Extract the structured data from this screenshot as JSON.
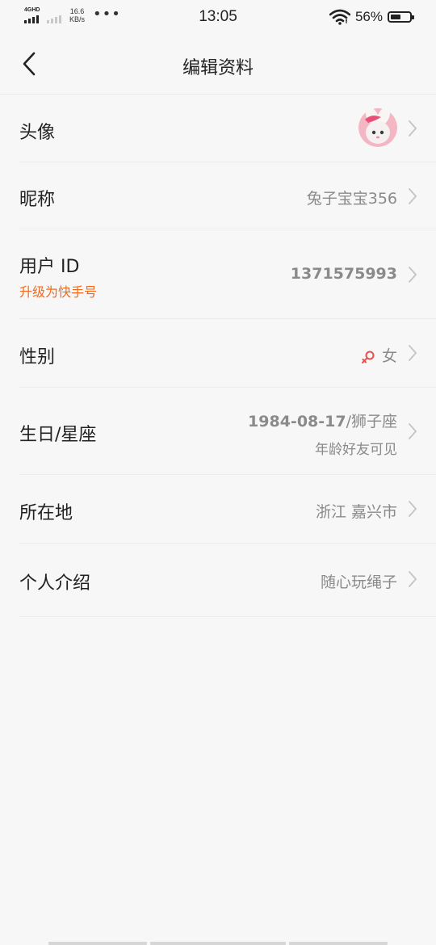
{
  "status_bar": {
    "network_tag": "4GHD",
    "speed_value": "16.6",
    "speed_unit": "KB/s",
    "more_dots": "•••",
    "time": "13:05",
    "battery_percent": "56%",
    "battery_level": 0.56
  },
  "header": {
    "title": "编辑资料",
    "back_icon": "chevron-left-icon"
  },
  "rows": {
    "avatar": {
      "label": "头像"
    },
    "nickname": {
      "label": "昵称",
      "value": "兔子宝宝356"
    },
    "user_id": {
      "label": "用户 ID",
      "sub": "升级为快手号",
      "value": "1371575993"
    },
    "gender": {
      "label": "性别",
      "value": "女",
      "icon": "female-icon"
    },
    "birthday": {
      "label": "生日/星座",
      "date": "1984-08-17",
      "zodiac": "/狮子座",
      "visibility": "年龄好友可见"
    },
    "location": {
      "label": "所在地",
      "value": "浙江 嘉兴市"
    },
    "intro": {
      "label": "个人介绍",
      "value": "随心玩绳子"
    }
  },
  "colors": {
    "accent_orange": "#f36a1d",
    "female_icon": "#e8504f",
    "value_gray": "#8a8a8a"
  }
}
